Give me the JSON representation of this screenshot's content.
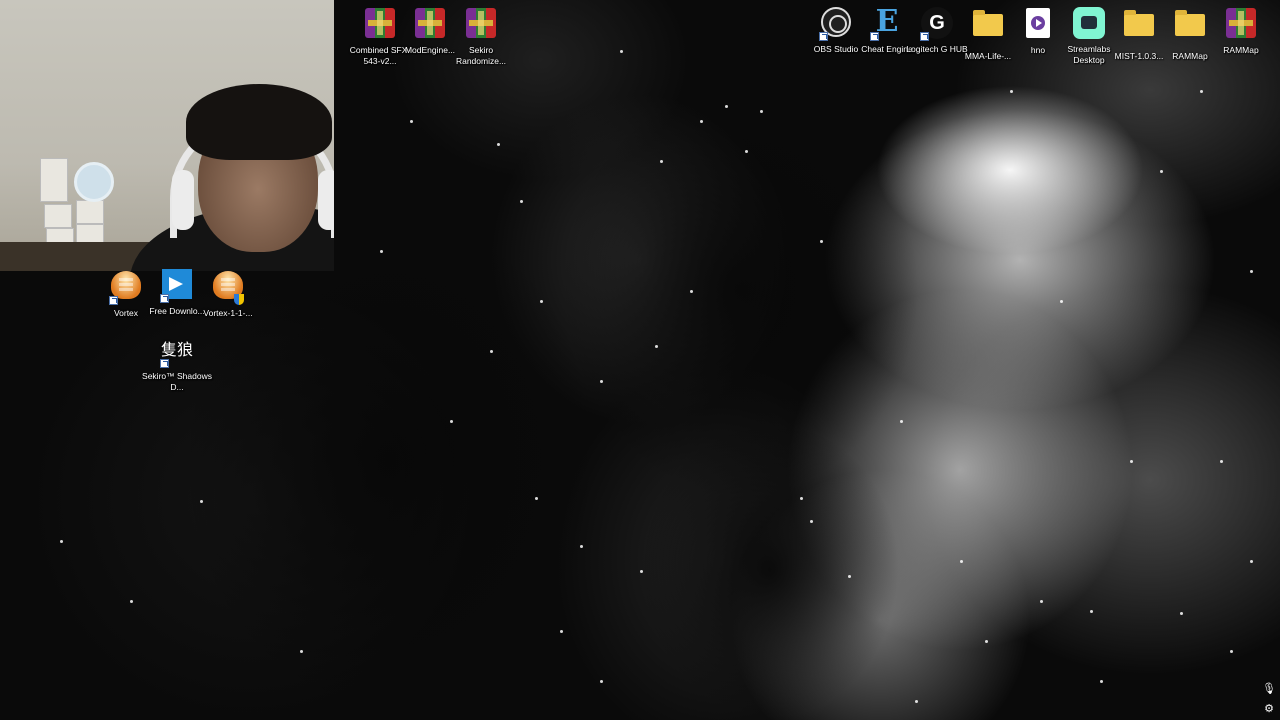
{
  "desktop_icons_top": [
    {
      "label": "Combined SFX-543-v2...",
      "icon": "winrar-archive-icon"
    },
    {
      "label": "ModEngine...",
      "icon": "winrar-archive-icon"
    },
    {
      "label": "Sekiro Randomize...",
      "icon": "winrar-archive-icon"
    }
  ],
  "desktop_icons_right": [
    {
      "label": "OBS Studio",
      "icon": "obs-studio-icon"
    },
    {
      "label": "Cheat Engine",
      "icon": "cheat-engine-icon"
    },
    {
      "label": "Logitech G HUB",
      "icon": "logitech-g-hub-icon"
    },
    {
      "label": "MMA-Life-...",
      "icon": "folder-icon"
    },
    {
      "label": "hno",
      "icon": "media-file-icon"
    },
    {
      "label": "Streamlabs Desktop",
      "icon": "streamlabs-icon"
    },
    {
      "label": "MIST-1.0.3...",
      "icon": "folder-icon"
    },
    {
      "label": "RAMMap",
      "icon": "folder-icon"
    },
    {
      "label": "RAMMap",
      "icon": "winrar-archive-icon"
    }
  ],
  "desktop_icons_left": [
    {
      "label": "Vortex",
      "icon": "vortex-icon"
    },
    {
      "label": "Free Downlo...",
      "icon": "free-download-manager-icon"
    },
    {
      "label": "Vortex-1-1-...",
      "icon": "vortex-installer-icon"
    },
    {
      "label": "Sekiro™ Shadows D...",
      "icon": "sekiro-icon",
      "glyph": "隻狼"
    }
  ],
  "tray": {
    "mic_icon": "microphone-icon",
    "settings_icon": "settings-icon"
  }
}
